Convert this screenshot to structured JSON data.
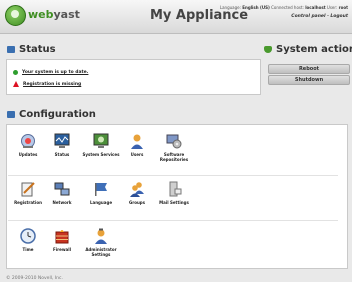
{
  "header": {
    "logo_web": "web",
    "logo_yast": "yast",
    "title": "My Appliance",
    "info_language_label": "Language:",
    "info_language": "English (US)",
    "info_host_label": "Connected host:",
    "info_host": "localhost",
    "info_user_label": "User:",
    "info_user": "root",
    "link_control_panel": "Control panel",
    "link_logout": "Logout"
  },
  "status": {
    "title": "Status",
    "items": [
      {
        "text": "Your system is up to date.",
        "kind": "ok"
      },
      {
        "text": "Registration is missing",
        "kind": "warning"
      }
    ]
  },
  "system_actions": {
    "title": "System actions",
    "buttons": [
      "Reboot",
      "Shutdown"
    ]
  },
  "configuration": {
    "title": "Configuration",
    "modules": [
      {
        "label": "Updates",
        "icon": "updates-icon"
      },
      {
        "label": "Status",
        "icon": "status-monitor-icon"
      },
      {
        "label": "System Services",
        "icon": "system-services-icon"
      },
      {
        "label": "Users",
        "icon": "user-icon"
      },
      {
        "label": "Software Repositories",
        "icon": "repositories-icon"
      },
      {
        "label": "Registration",
        "icon": "registration-icon"
      },
      {
        "label": "Network",
        "icon": "network-icon"
      },
      {
        "label": "Language",
        "icon": "language-flag-icon"
      },
      {
        "label": "Groups",
        "icon": "groups-icon"
      },
      {
        "label": "Mail Settings",
        "icon": "mail-settings-icon"
      },
      {
        "label": "Time",
        "icon": "clock-icon"
      },
      {
        "label": "Firewall",
        "icon": "firewall-icon"
      },
      {
        "label": "Administrator Settings",
        "icon": "administrator-icon"
      }
    ]
  },
  "footer": {
    "copyright": "© 2009-2010 Novell, Inc."
  },
  "colors": {
    "brand_green": "#3f8e22",
    "warning_red": "#dd1122",
    "ok_green": "#2e9e2e"
  }
}
